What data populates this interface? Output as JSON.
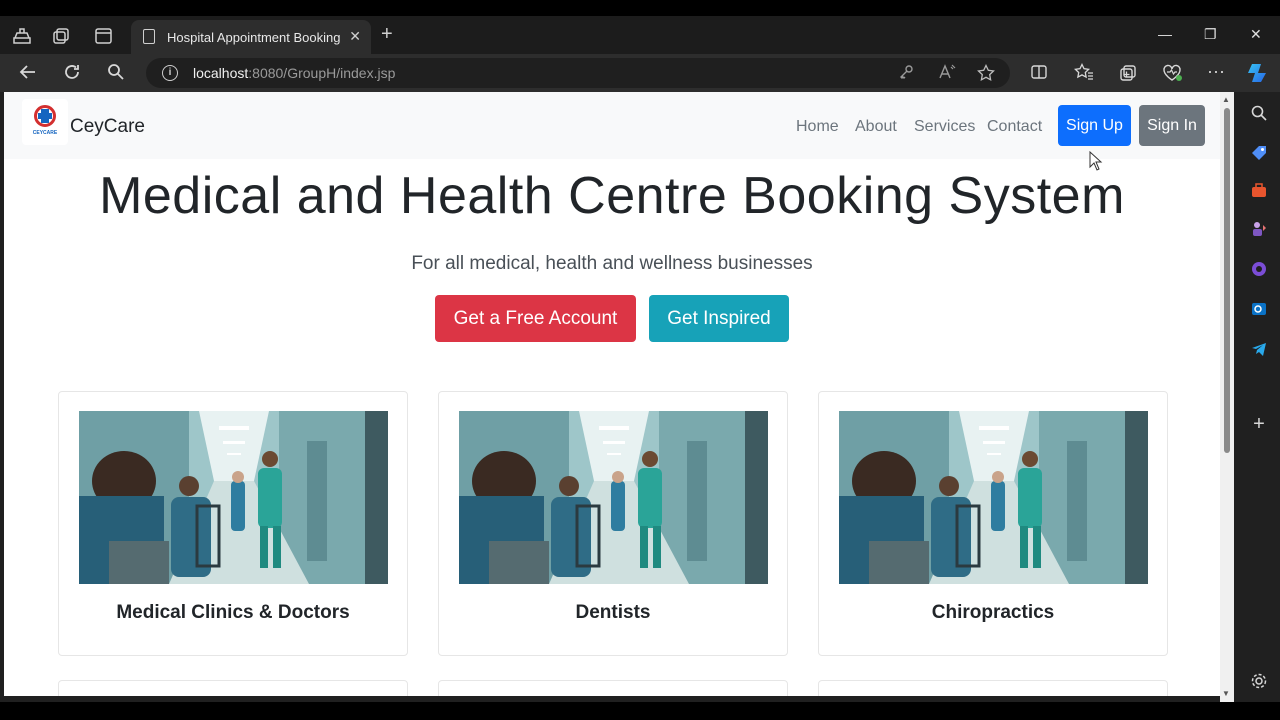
{
  "browser": {
    "tab_title": "Hospital Appointment Booking S",
    "url_host": "localhost",
    "url_rest": ":8080/GroupH/index.jsp",
    "new_tab_symbol": "+",
    "tab_close_symbol": "✕",
    "window_controls": {
      "minimize": "—",
      "restore": "❐",
      "close": "✕"
    },
    "toolbar_icons": [
      "reading-view-icon",
      "favorites-icon",
      "collections-icon",
      "browser-essentials-icon",
      "more-icon",
      "copilot-icon"
    ],
    "sidebar_icons": [
      "search-icon",
      "shopping-icon",
      "tools-icon",
      "games-icon",
      "copilot-sidebar-icon",
      "outlook-icon",
      "telegram-icon",
      "add-icon",
      "settings-icon"
    ]
  },
  "navbar": {
    "brand": "CeyCare",
    "logo_text": "CEYCARE",
    "links": [
      "Home",
      "About",
      "Services",
      "Contact"
    ],
    "signup_label": "Sign Up",
    "signin_label": "Sign In"
  },
  "hero": {
    "title": "Medical and Health Centre Booking System",
    "subtitle": "For all medical, health and wellness businesses",
    "primary_cta": "Get a Free Account",
    "secondary_cta": "Get Inspired"
  },
  "cards": [
    {
      "caption": "Medical Clinics & Doctors"
    },
    {
      "caption": "Dentists"
    },
    {
      "caption": "Chiropractics"
    }
  ],
  "colors": {
    "primary": "#0d6efd",
    "secondary": "#6c757d",
    "danger": "#dc3545",
    "info": "#17a2b8"
  }
}
